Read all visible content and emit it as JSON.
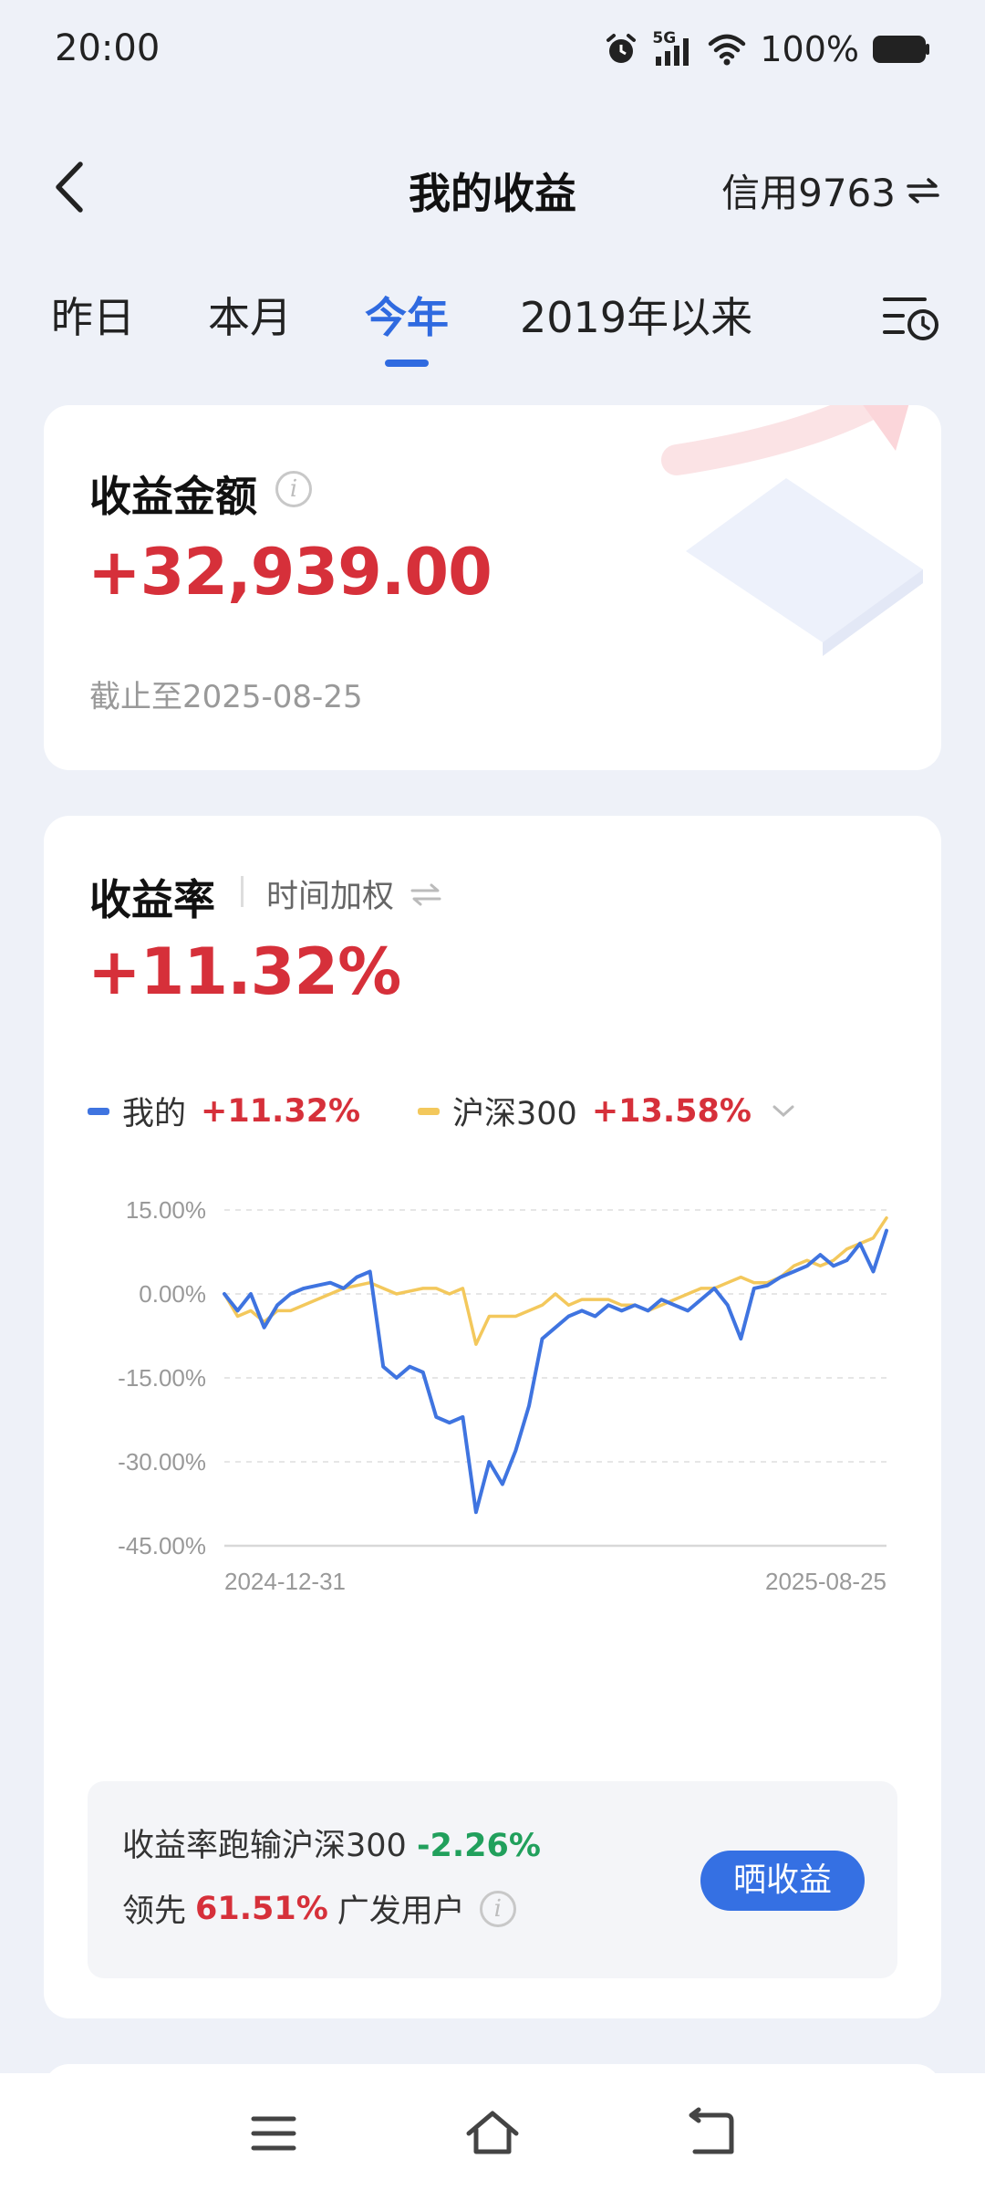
{
  "status_bar": {
    "time": "20:00",
    "network": "5G",
    "battery": "100%"
  },
  "header": {
    "title": "我的收益",
    "account": "信用9763"
  },
  "tabs": [
    {
      "label": "昨日",
      "active": false
    },
    {
      "label": "本月",
      "active": false
    },
    {
      "label": "今年",
      "active": true
    },
    {
      "label": "2019年以来",
      "active": false
    }
  ],
  "earnings": {
    "title": "收益金额",
    "amount": "+32,939.00",
    "as_of": "截止至2025-08-25"
  },
  "return_rate": {
    "title": "收益率",
    "method": "时间加权",
    "value": "+11.32%",
    "legend": [
      {
        "name": "我的",
        "value": "+11.32%",
        "color": "#3f74e0"
      },
      {
        "name": "沪深300",
        "value": "+13.58%",
        "color": "#f3c85c"
      }
    ]
  },
  "chart_data": {
    "type": "line",
    "y_ticks": [
      "15.00%",
      "0.00%",
      "-15.00%",
      "-30.00%",
      "-45.00%"
    ],
    "x_labels": [
      "2024-12-31",
      "2025-08-25"
    ],
    "ylim": [
      -45,
      15
    ],
    "x": [
      0,
      2,
      4,
      6,
      8,
      10,
      12,
      14,
      16,
      18,
      20,
      22,
      24,
      26,
      28,
      30,
      32,
      34,
      36,
      38,
      40,
      42,
      44,
      46,
      48,
      50,
      52,
      54,
      56,
      58,
      60,
      62,
      64,
      66,
      68,
      70,
      72,
      74,
      76,
      78,
      80,
      82,
      84,
      86,
      88,
      90,
      92,
      94,
      96,
      98,
      100
    ],
    "series": [
      {
        "name": "我的",
        "color": "#3f74e0",
        "values": [
          0,
          -3,
          0,
          -6,
          -2,
          0,
          1,
          1.5,
          2,
          1,
          3,
          4,
          -13,
          -15,
          -13,
          -14,
          -22,
          -23,
          -22,
          -39,
          -30,
          -34,
          -28,
          -20,
          -8,
          -6,
          -4,
          -3,
          -4,
          -2,
          -3,
          -2,
          -3,
          -1,
          -2,
          -3,
          -1,
          1,
          -2,
          -8,
          1,
          1.5,
          3,
          4,
          5,
          7,
          5,
          6,
          9,
          4,
          11.32
        ]
      },
      {
        "name": "沪深300",
        "color": "#f3c85c",
        "values": [
          0,
          -4,
          -3,
          -5,
          -3,
          -3,
          -2,
          -1,
          0,
          1,
          1.5,
          2,
          1,
          0,
          0.5,
          1,
          1,
          0,
          1,
          -9,
          -4,
          -4,
          -4,
          -3,
          -2,
          0,
          -2,
          -1,
          -1,
          -1,
          -2,
          -2,
          -3,
          -2,
          -1,
          0,
          1,
          1,
          2,
          3,
          2,
          2,
          3,
          5,
          6,
          5,
          6,
          8,
          9,
          10,
          13.58
        ]
      }
    ]
  },
  "summary": {
    "line1_prefix": "收益率跑输沪深300",
    "line1_value": "-2.26%",
    "line2_prefix": "领先",
    "line2_value": "61.51%",
    "line2_suffix": "广发用户",
    "share_label": "晒收益"
  }
}
